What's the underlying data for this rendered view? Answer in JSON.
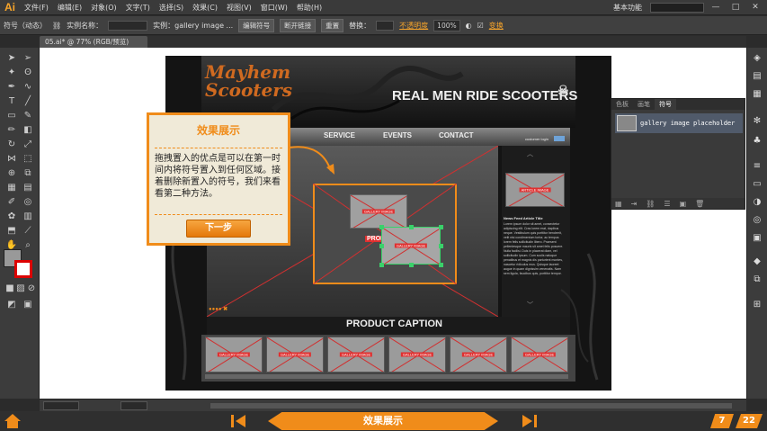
{
  "app": {
    "logo": "Ai"
  },
  "menu": {
    "items": [
      "文件(F)",
      "编辑(E)",
      "对象(O)",
      "文字(T)",
      "选择(S)",
      "效果(C)",
      "视图(V)",
      "窗口(W)",
      "帮助(H)"
    ],
    "workspace": "基本功能"
  },
  "control": {
    "mode": "符号（动态）",
    "instance_label": "实例名称：",
    "instance_value": "实例：gallery image ...",
    "edit_symbol": "编辑符号",
    "break_link": "断开链接",
    "reset": "重置",
    "replace_label": "替换：",
    "opacity_label": "不透明度",
    "opacity_value": "100%",
    "transform_link": "变换"
  },
  "document": {
    "tab_title": "05.ai* @ 77% (RGB/预览)"
  },
  "artboard": {
    "brand_logo": "Mayhem Scooters",
    "headline": "REAL MEN RIDE SCOOTERS",
    "nav": [
      "SERVICE",
      "EVENTS",
      "CONTACT"
    ],
    "customer_login": "customer login",
    "article_image": "ARTICLE IMAGE",
    "news_title": "News Feed Article Title",
    "news_body": "Lorem ipsum dolor sit amet, consectetur adipiscing elit. Cras lorem erat, dapibus neque. Vestibulum quis porttitor hendrerit, velit nisi condimentum tortor, ac tempus lorem felis sollicitudin libero. Praesent pellentesque mauris sit amet felis posuere. Nulla facilisi. Duis in placerat diam, vel sollicitudin ipsum. Cum sociis natoque penatibus et magnis dis parturient montes, nascetur ridiculus mus. Quisque laoreet augue in quam dignissim venenatis. Nam sem ligula, faucibus quis, porttitor tempor.",
    "gallery_image_label": "GALLERY IMAGE",
    "product_partial": "PROD",
    "product_caption": "PRODUCT CAPTION",
    "gallery_row": [
      "GALLERY IMAGE",
      "GALLERY IMAGE",
      "GALLERY IMAGE",
      "GALLERY IMAGE",
      "GALLERY IMAGE",
      "GALLERY IMAGE"
    ]
  },
  "callout": {
    "title": "效果展示",
    "body": "拖拽置入的优点是可以在第一时间内将符号置入到任何区域。接着删除新置入的符号，我们来看看第二种方法。",
    "button": "下一步"
  },
  "symbols_panel": {
    "tabs": [
      "色板",
      "画笔",
      "符号"
    ],
    "active_tab": "符号",
    "item": "gallery image placeholder"
  },
  "tutorial": {
    "title": "效果展示",
    "page_current": "7",
    "page_total": "22"
  },
  "colors": {
    "accent": "#f08c1a",
    "placeholder_red": "#e03030",
    "selection_green": "#3ad16a"
  }
}
